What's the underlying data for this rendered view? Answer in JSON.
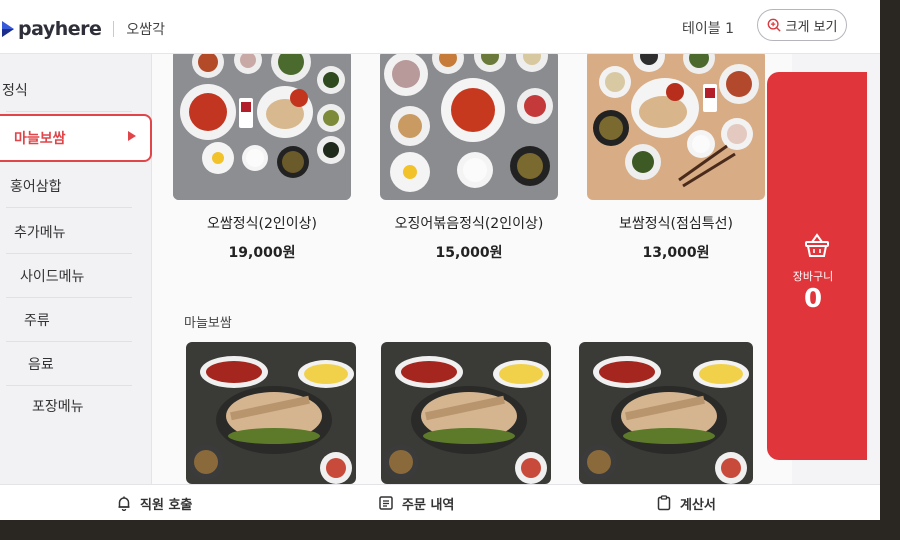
{
  "header": {
    "brand": "payhere",
    "store_name": "오쌈각",
    "table": "테이블 1",
    "zoom_button": "크게 보기"
  },
  "sidebar": {
    "items": [
      {
        "label": "정식"
      },
      {
        "label": "마늘보쌈",
        "active": true
      },
      {
        "label": "홍어삼합"
      },
      {
        "label": "추가메뉴"
      },
      {
        "label": "사이드메뉴"
      },
      {
        "label": "주류"
      },
      {
        "label": "음료"
      },
      {
        "label": "포장메뉴"
      }
    ]
  },
  "menu": {
    "items": [
      {
        "name": "오쌈정식(2인이상)",
        "price": "19,000원"
      },
      {
        "name": "오징어볶음정식(2인이상)",
        "price": "15,000원"
      },
      {
        "name": "보쌈정식(점심특선)",
        "price": "13,000원"
      }
    ],
    "section_title": "마늘보쌈",
    "section_items": [
      {},
      {},
      {}
    ]
  },
  "cart": {
    "label": "장바구니",
    "count": "0"
  },
  "bottom_bar": {
    "call_staff": "직원 호출",
    "order_history": "주문 내역",
    "bill": "계산서"
  },
  "colors": {
    "accent": "#e0363b",
    "active_border": "#e0454a"
  },
  "icons": [
    "logo-mark-icon",
    "search-zoom-icon",
    "chevron-right-icon",
    "basket-icon",
    "bell-icon",
    "receipt-list-icon",
    "clipboard-icon"
  ]
}
